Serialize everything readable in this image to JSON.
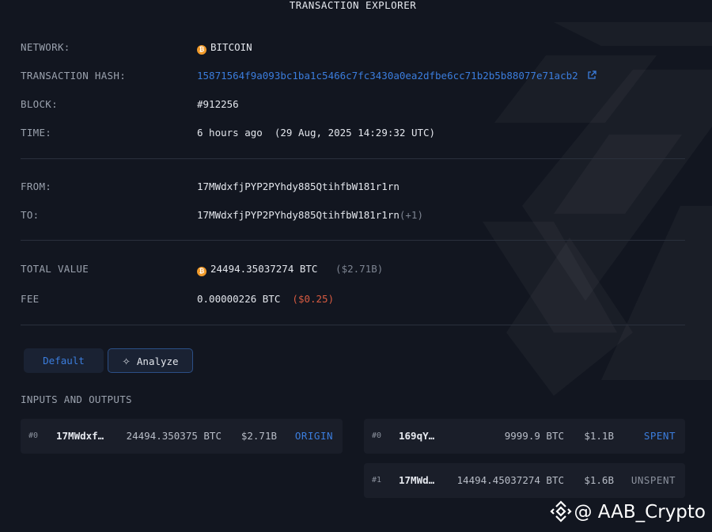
{
  "header": {
    "title": "TRANSACTION EXPLORER"
  },
  "details": {
    "network_label": "NETWORK:",
    "network_value": "BITCOIN",
    "network_icon": "bitcoin-icon",
    "hash_label": "TRANSACTION HASH:",
    "hash_value": "15871564f9a093bc1ba1c5466c7fc3430a0ea2dfbe6cc71b2b5b88077e71acb2",
    "block_label": "BLOCK:",
    "block_value": "#912256",
    "time_label": "TIME:",
    "time_relative": "6 hours ago",
    "time_absolute": "(29 Aug, 2025 14:29:32 UTC)",
    "from_label": "FROM:",
    "from_value": "17MWdxfjPYP2PYhdy885QtihfbW181r1rn",
    "to_label": "TO:",
    "to_value": "17MWdxfjPYP2PYhdy885QtihfbW181r1rn",
    "to_extra": "(+1)",
    "total_label": "TOTAL VALUE",
    "total_btc": "24494.35037274 BTC",
    "total_usd": "($2.71B)",
    "fee_label": "FEE",
    "fee_btc": "0.00000226 BTC",
    "fee_usd": "($0.25)"
  },
  "tabs": [
    {
      "label": "Default"
    },
    {
      "label": "Analyze",
      "icon": "analyze-icon"
    }
  ],
  "io": {
    "title": "INPUTS AND OUTPUTS",
    "inputs": [
      {
        "index": "#0",
        "address": "17MWdxf…",
        "amount": "24494.350375 BTC",
        "usd": "$2.71B",
        "status": "ORIGIN"
      }
    ],
    "outputs": [
      {
        "index": "#0",
        "address": "169qY…",
        "amount": "9999.9 BTC",
        "usd": "$1.1B",
        "status": "SPENT"
      },
      {
        "index": "#1",
        "address": "17MWd…",
        "amount": "14494.45037274 BTC",
        "usd": "$1.6B",
        "status": "UNSPENT"
      }
    ]
  },
  "watermark": {
    "text": "@ AAB_Crypto",
    "icon": "binance-logo-icon"
  },
  "colors": {
    "background": "#121620",
    "accent_blue": "#3b7ddd",
    "fee_red": "#d85b41",
    "bitcoin_orange": "#f09a2a",
    "card": "#1a1e29"
  }
}
